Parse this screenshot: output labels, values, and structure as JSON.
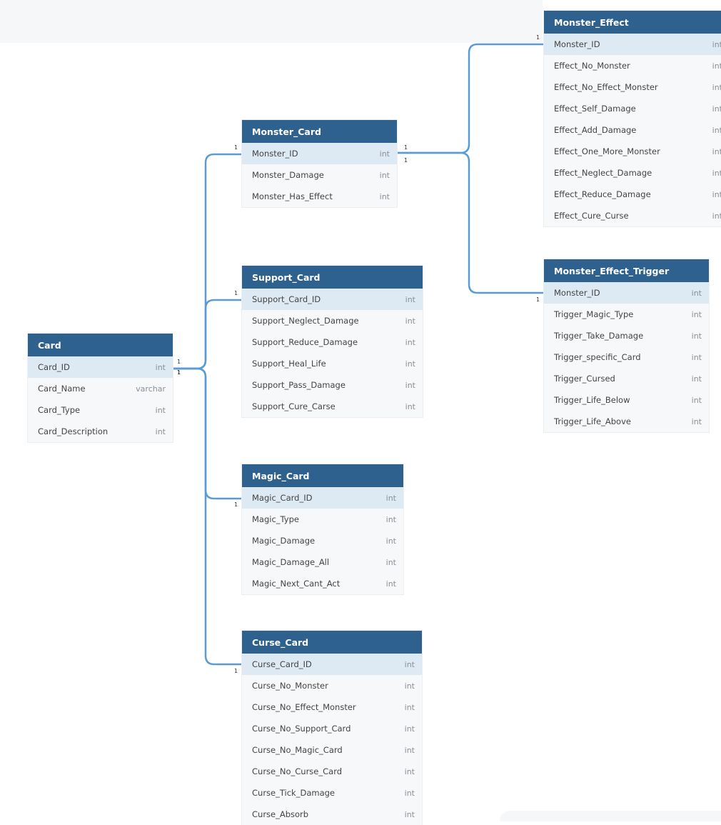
{
  "diagram": {
    "tables": [
      {
        "name": "Card",
        "columns": [
          {
            "name": "Card_ID",
            "type": "int",
            "pk": true
          },
          {
            "name": "Card_Name",
            "type": "varchar"
          },
          {
            "name": "Card_Type",
            "type": "int"
          },
          {
            "name": "Card_Description",
            "type": "int"
          }
        ]
      },
      {
        "name": "Monster_Card",
        "columns": [
          {
            "name": "Monster_ID",
            "type": "int",
            "pk": true
          },
          {
            "name": "Monster_Damage",
            "type": "int"
          },
          {
            "name": "Monster_Has_Effect",
            "type": "int"
          }
        ]
      },
      {
        "name": "Support_Card",
        "columns": [
          {
            "name": "Support_Card_ID",
            "type": "int",
            "pk": true
          },
          {
            "name": "Support_Neglect_Damage",
            "type": "int"
          },
          {
            "name": "Support_Reduce_Damage",
            "type": "int"
          },
          {
            "name": "Support_Heal_Life",
            "type": "int"
          },
          {
            "name": "Support_Pass_Damage",
            "type": "int"
          },
          {
            "name": "Support_Cure_Carse",
            "type": "int"
          }
        ]
      },
      {
        "name": "Magic_Card",
        "columns": [
          {
            "name": "Magic_Card_ID",
            "type": "int",
            "pk": true
          },
          {
            "name": "Magic_Type",
            "type": "int"
          },
          {
            "name": "Magic_Damage",
            "type": "int"
          },
          {
            "name": "Magic_Damage_All",
            "type": "int"
          },
          {
            "name": "Magic_Next_Cant_Act",
            "type": "int"
          }
        ]
      },
      {
        "name": "Curse_Card",
        "columns": [
          {
            "name": "Curse_Card_ID",
            "type": "int",
            "pk": true
          },
          {
            "name": "Curse_No_Monster",
            "type": "int"
          },
          {
            "name": "Curse_No_Effect_Monster",
            "type": "int"
          },
          {
            "name": "Curse_No_Support_Card",
            "type": "int"
          },
          {
            "name": "Curse_No_Magic_Card",
            "type": "int"
          },
          {
            "name": "Curse_No_Curse_Card",
            "type": "int"
          },
          {
            "name": "Curse_Tick_Damage",
            "type": "int"
          },
          {
            "name": "Curse_Absorb",
            "type": "int"
          }
        ]
      },
      {
        "name": "Monster_Effect",
        "columns": [
          {
            "name": "Monster_ID",
            "type": "int",
            "pk": true
          },
          {
            "name": "Effect_No_Monster",
            "type": "int"
          },
          {
            "name": "Effect_No_Effect_Monster",
            "type": "int"
          },
          {
            "name": "Effect_Self_Damage",
            "type": "int"
          },
          {
            "name": "Effect_Add_Damage",
            "type": "int"
          },
          {
            "name": "Effect_One_More_Monster",
            "type": "int"
          },
          {
            "name": "Effect_Neglect_Damage",
            "type": "int"
          },
          {
            "name": "Effect_Reduce_Damage",
            "type": "int"
          },
          {
            "name": "Effect_Cure_Curse",
            "type": "int"
          }
        ]
      },
      {
        "name": "Monster_Effect_Trigger",
        "columns": [
          {
            "name": "Monster_ID",
            "type": "int",
            "pk": true
          },
          {
            "name": "Trigger_Magic_Type",
            "type": "int"
          },
          {
            "name": "Trigger_Take_Damage",
            "type": "int"
          },
          {
            "name": "Trigger_specific_Card",
            "type": "int"
          },
          {
            "name": "Trigger_Cursed",
            "type": "int"
          },
          {
            "name": "Trigger_Life_Below",
            "type": "int"
          },
          {
            "name": "Trigger_Life_Above",
            "type": "int"
          }
        ]
      }
    ],
    "relationships": [
      {
        "from": "Card.Card_ID",
        "to": "Monster_Card.Monster_ID",
        "from_cardinality": "1",
        "to_cardinality": "1"
      },
      {
        "from": "Card.Card_ID",
        "to": "Support_Card.Support_Card_ID",
        "from_cardinality": "1",
        "to_cardinality": "1"
      },
      {
        "from": "Card.Card_ID",
        "to": "Magic_Card.Magic_Card_ID",
        "from_cardinality": "1",
        "to_cardinality": "1"
      },
      {
        "from": "Card.Card_ID",
        "to": "Curse_Card.Curse_Card_ID",
        "from_cardinality": "1",
        "to_cardinality": "1"
      },
      {
        "from": "Monster_Card.Monster_ID",
        "to": "Monster_Effect.Monster_ID",
        "from_cardinality": "1",
        "to_cardinality": "1"
      },
      {
        "from": "Monster_Card.Monster_ID",
        "to": "Monster_Effect_Trigger.Monster_ID",
        "from_cardinality": "1",
        "to_cardinality": "1"
      }
    ]
  }
}
